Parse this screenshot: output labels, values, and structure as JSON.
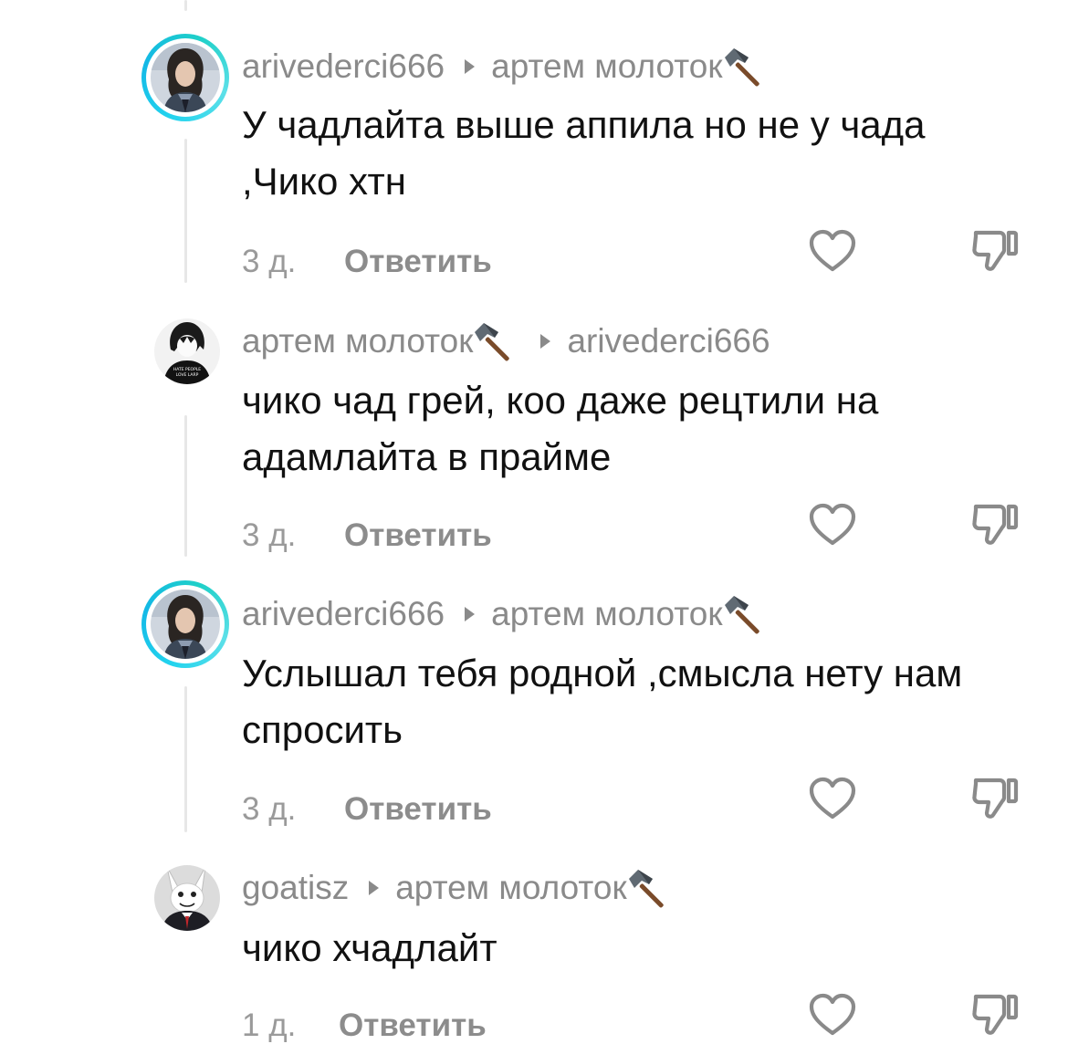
{
  "comments": [
    {
      "username": "arivederci666",
      "reply_to": "артем молоток",
      "reply_to_has_hammer": true,
      "author_hammer": false,
      "text": "У чадлайта выше аппила но не у чада ,Чико хтн",
      "time": "3 д.",
      "reply_label": "Ответить",
      "avatar": "avatar-portrait-ringed"
    },
    {
      "username": "артем молоток",
      "reply_to": "arivederci666",
      "reply_to_has_hammer": false,
      "author_hammer": true,
      "text": "чико чад грей, коо даже рецтили на адамлайта в прайме",
      "time": "3 д.",
      "reply_label": "Ответить",
      "avatar": "avatar-anime-shirt",
      "avatar_caption": "HATE PEOPLE LOVE LARP"
    },
    {
      "username": "arivederci666",
      "reply_to": "артем молоток",
      "reply_to_has_hammer": true,
      "author_hammer": false,
      "text": "Услышал тебя родной ,смысла нету нам спросить",
      "time": "3 д.",
      "reply_label": "Ответить",
      "avatar": "avatar-portrait-ringed"
    },
    {
      "username": "goatisz",
      "reply_to": "артем молоток",
      "reply_to_has_hammer": true,
      "author_hammer": false,
      "text": "чико хчадлайт",
      "time": "1 д.",
      "reply_label": "Ответить",
      "avatar": "avatar-rabbid"
    }
  ],
  "icons": {
    "like": "heart-outline-icon",
    "dislike": "thumbs-down-outline-icon",
    "emoji": "hammer-emoji",
    "separator": "triangle-right-icon"
  },
  "colors": {
    "ring": "#22d3ee",
    "meta_text": "#8a8a8a",
    "body_text": "#111111",
    "thread_line": "#e7e7e7"
  }
}
